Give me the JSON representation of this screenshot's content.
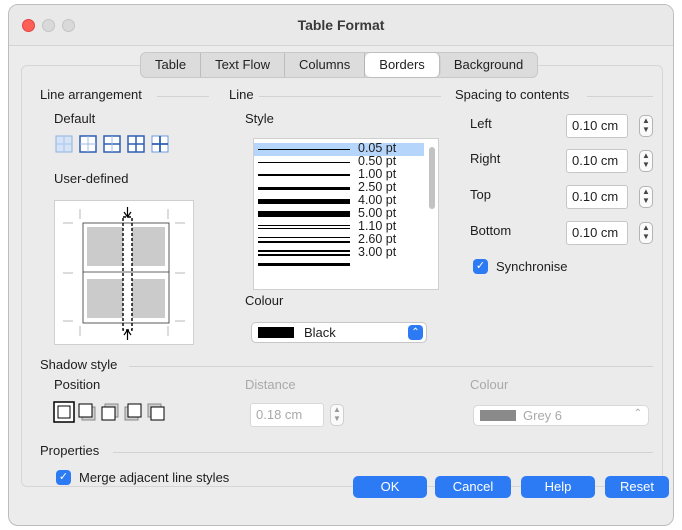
{
  "window": {
    "title": "Table Format"
  },
  "tabs": [
    "Table",
    "Text Flow",
    "Columns",
    "Borders",
    "Background"
  ],
  "active_tab": "Borders",
  "line_arrangement": {
    "heading": "Line arrangement",
    "default_label": "Default",
    "user_defined_label": "User-defined"
  },
  "line": {
    "heading": "Line",
    "style_label": "Style",
    "styles": [
      "0.05 pt",
      "0.50 pt",
      "1.00 pt",
      "2.50 pt",
      "4.00 pt",
      "5.00 pt",
      "1.10 pt",
      "2.60 pt",
      "3.00 pt"
    ],
    "selected_style": "0.05 pt",
    "colour_label": "Colour",
    "colour_value": "Black",
    "colour_swatch": "#000000"
  },
  "spacing": {
    "heading": "Spacing to contents",
    "left_label": "Left",
    "left_value": "0.10 cm",
    "right_label": "Right",
    "right_value": "0.10 cm",
    "top_label": "Top",
    "top_value": "0.10 cm",
    "bottom_label": "Bottom",
    "bottom_value": "0.10 cm",
    "synchronise_label": "Synchronise",
    "synchronise_checked": true
  },
  "shadow": {
    "heading": "Shadow style",
    "position_label": "Position",
    "distance_label": "Distance",
    "distance_value": "0.18 cm",
    "colour_label": "Colour",
    "colour_value": "Grey 6",
    "colour_swatch": "#8a8a8a"
  },
  "properties": {
    "heading": "Properties",
    "merge_label": "Merge adjacent line styles",
    "merge_checked": true
  },
  "buttons": {
    "ok": "OK",
    "cancel": "Cancel",
    "help": "Help",
    "reset": "Reset"
  },
  "colors": {
    "accent": "#2c7bf5",
    "close": "#fe5f57",
    "selection": "#b5d5fb"
  }
}
